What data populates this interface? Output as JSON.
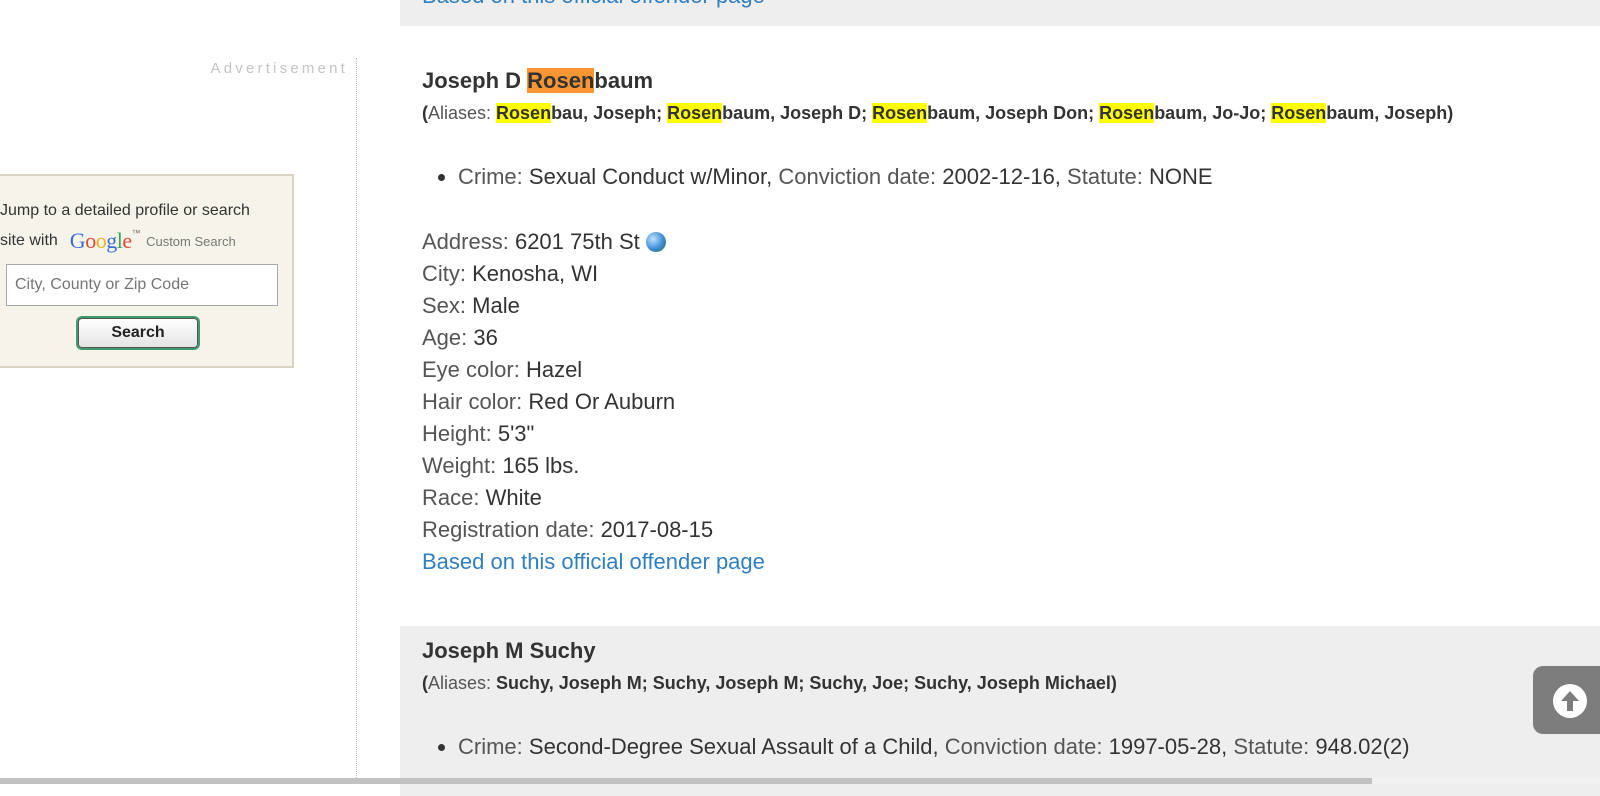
{
  "sidebar": {
    "ad_label": "Advertisement",
    "search_prompt_line1": "Jump to a detailed profile or search",
    "search_prompt_line2": "site with",
    "google_brand": "Google",
    "google_tm": "TM",
    "custom_search_label": "Custom Search",
    "search_placeholder": "City, County or Zip Code",
    "search_button_label": "Search"
  },
  "records": [
    {
      "source_link": "Based on this official offender page"
    },
    {
      "name_first": "Joseph D ",
      "name_hl": "Rosen",
      "name_rest": "baum",
      "aliases_label": "Aliases:",
      "aliases": [
        {
          "hl": "Rosen",
          "rest": "bau, Joseph"
        },
        {
          "hl": "Rosen",
          "rest": "baum, Joseph D"
        },
        {
          "hl": "Rosen",
          "rest": "baum, Joseph Don"
        },
        {
          "hl": "Rosen",
          "rest": "baum, Jo-Jo"
        },
        {
          "hl": "Rosen",
          "rest": "baum, Joseph"
        }
      ],
      "crime_label": "Crime:",
      "crime": "Sexual Conduct w/Minor,",
      "conviction_label": "Conviction date:",
      "conviction_date": "2002-12-16,",
      "statute_label": "Statute:",
      "statute": "NONE",
      "address_label": "Address:",
      "address": "6201 75th St",
      "city_label": "City:",
      "city": "Kenosha, WI",
      "sex_label": "Sex:",
      "sex": "Male",
      "age_label": "Age:",
      "age": "36",
      "eye_label": "Eye color:",
      "eye": "Hazel",
      "hair_label": "Hair color:",
      "hair": "Red Or Auburn",
      "height_label": "Height:",
      "height": "5'3\"",
      "weight_label": "Weight:",
      "weight": "165 lbs.",
      "race_label": "Race:",
      "race": "White",
      "registration_label": "Registration date:",
      "registration_date": "2017-08-15",
      "source_link": "Based on this official offender page"
    },
    {
      "name": "Joseph M Suchy",
      "aliases_label": "Aliases:",
      "aliases_text": "Suchy, Joseph M; Suchy, Joseph M; Suchy, Joe; Suchy, Joseph Michael)",
      "crime_label": "Crime:",
      "crime": "Second-Degree Sexual Assault of a Child,",
      "conviction_label": "Conviction date:",
      "conviction_date": "1997-05-28,",
      "statute_label": "Statute:",
      "statute": "948.02(2)"
    }
  ],
  "colors": {
    "link": "#2f7fc1",
    "highlight_yellow": "#ffff00",
    "highlight_orange": "#f79632",
    "shaded_bg": "#eeeeee"
  },
  "icons": {
    "map": "globe-icon",
    "scroll_top": "arrow-up-circle-icon"
  }
}
